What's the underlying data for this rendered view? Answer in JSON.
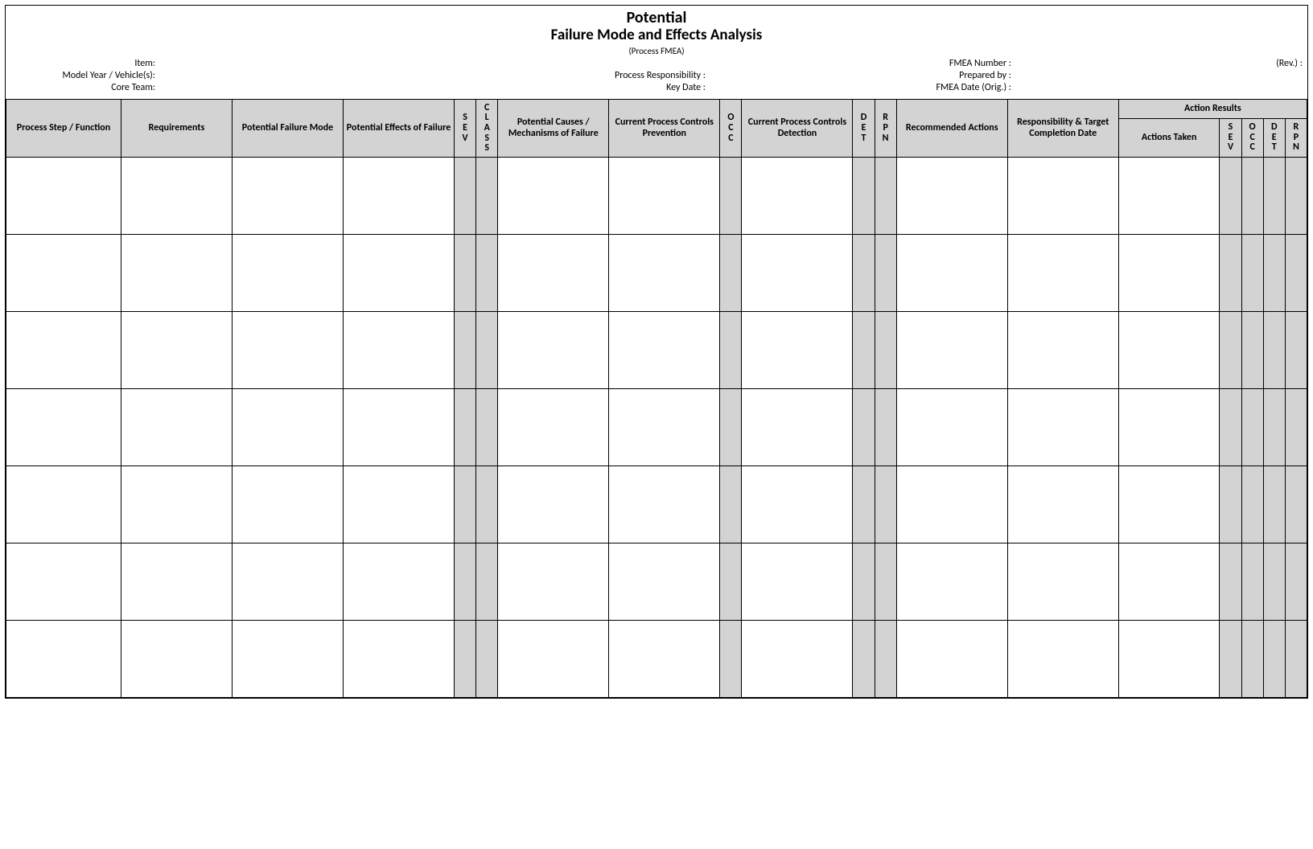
{
  "title": {
    "line1": "Potential",
    "line2": "Failure Mode and Effects Analysis",
    "line3": "(Process FMEA)"
  },
  "meta": {
    "item_label": "Item:",
    "model_year_label": "Model Year / Vehicle(s):",
    "core_team_label": "Core Team:",
    "proc_resp_label": "Process Responsibility :",
    "key_date_label": "Key Date :",
    "fmea_number_label": "FMEA Number :",
    "prepared_by_label": "Prepared by :",
    "fmea_date_label": "FMEA Date (Orig.) :",
    "rev_label": "(Rev.) :"
  },
  "headers": {
    "process_step": "Process Step / Function",
    "requirements": "Requirements",
    "failure_mode": "Potential Failure Mode",
    "failure_effect": "Potential Effects of Failure",
    "sev": "SEV",
    "class": "CLASS",
    "cause": "Potential Causes / Mechanisms of Failure",
    "prevention": "Current Process Controls Prevention",
    "occ": "OCC",
    "detection": "Current Process Controls Detection",
    "det": "DET",
    "rpn": "RPN",
    "recommended": "Recommended Actions",
    "responsibility": "Responsibility & Target Completion Date",
    "action_results": "Action Results",
    "actions_taken": "Actions Taken",
    "sev2": "SEV",
    "occ2": "OCC",
    "det2": "DET",
    "rpn2": "RPN"
  },
  "rows": 7
}
